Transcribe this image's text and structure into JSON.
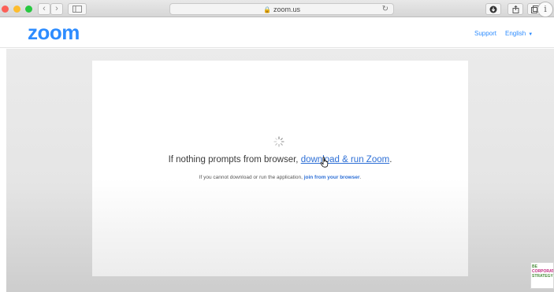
{
  "browser": {
    "url": "zoom.us",
    "back_glyph": "‹",
    "forward_glyph": "›",
    "reload_glyph": "↻",
    "info_glyph": "i",
    "icons": [
      "back-icon",
      "forward-icon",
      "sidebar-icon",
      "lock-icon",
      "reload-icon",
      "download-icon",
      "share-icon",
      "tabs-icon",
      "info-icon"
    ]
  },
  "header": {
    "logo": "zoom",
    "support": "Support",
    "language": "English"
  },
  "main": {
    "prompt_text": "If nothing prompts from browser, ",
    "prompt_link": "download & run Zoom",
    "prompt_end": ".",
    "sub_text": "If you cannot download or run the application, ",
    "sub_link": "join from your browser",
    "sub_end": "."
  },
  "watermark": {
    "line1": "BE",
    "line2": "CORPORATE",
    "line3": "STRATEGY"
  },
  "colors": {
    "brand": "#2d8cff",
    "link": "#2d6fd6"
  }
}
